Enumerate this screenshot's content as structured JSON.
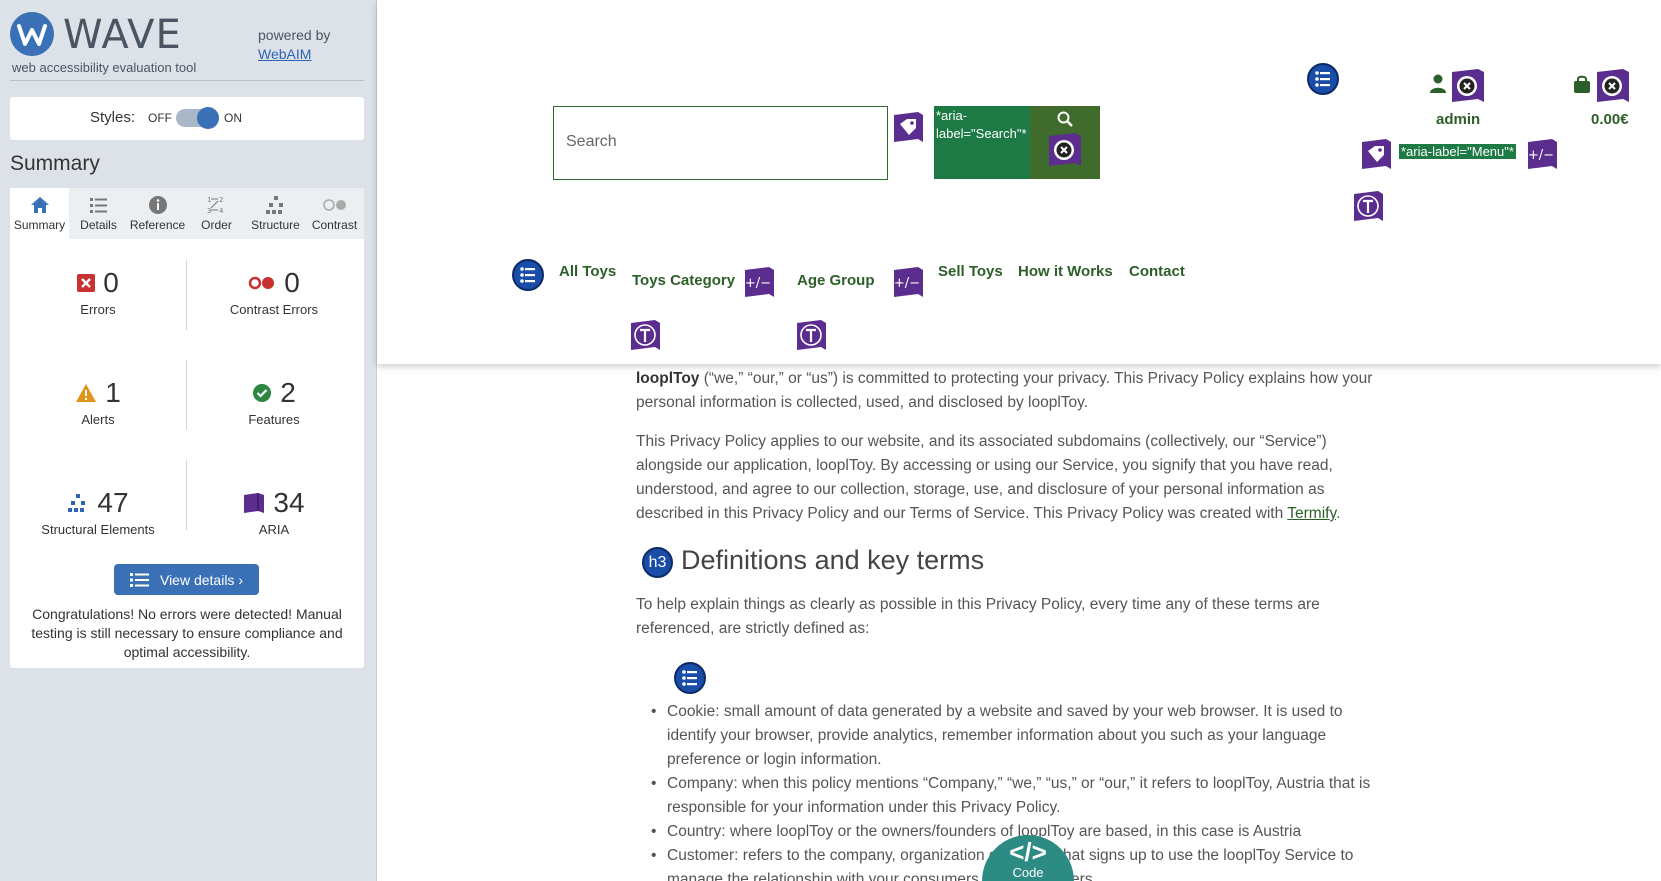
{
  "wave": {
    "title": "WAVE",
    "subtitle": "web accessibility evaluation tool",
    "powered_by": "powered by",
    "webaim_link": "WebAIM",
    "styles_label": "Styles:",
    "styles_off": "OFF",
    "styles_on": "ON",
    "styles_enabled": true,
    "summary_heading": "Summary",
    "tabs": [
      {
        "label": "Summary",
        "icon": "home-icon",
        "active": true
      },
      {
        "label": "Details",
        "icon": "list-icon",
        "active": false
      },
      {
        "label": "Reference",
        "icon": "info-icon",
        "active": false
      },
      {
        "label": "Order",
        "icon": "order-icon",
        "active": false
      },
      {
        "label": "Structure",
        "icon": "structure-icon",
        "active": false
      },
      {
        "label": "Contrast",
        "icon": "contrast-icon",
        "active": false
      }
    ],
    "stats": {
      "errors": {
        "value": "0",
        "label": "Errors"
      },
      "contrast_errors": {
        "value": "0",
        "label": "Contrast Errors"
      },
      "alerts": {
        "value": "1",
        "label": "Alerts"
      },
      "features": {
        "value": "2",
        "label": "Features"
      },
      "structural": {
        "value": "47",
        "label": "Structural Elements"
      },
      "aria": {
        "value": "34",
        "label": "ARIA"
      }
    },
    "view_details": "View details ›",
    "congrats": "Congratulations! No errors were detected! Manual testing is still necessary to ensure compliance and optimal accessibility.",
    "colors": {
      "accent": "#3a70b6",
      "error": "#c8312f",
      "alert": "#e0951b",
      "feature": "#2e8540",
      "aria": "#5b2d8e"
    }
  },
  "header": {
    "search_placeholder": "Search",
    "search_aria_label": "*aria-label=\"Search\"*",
    "menu_aria_label": "*aria-label=\"Menu\"*",
    "plus_minus": "+/−",
    "account_label": "admin",
    "cart_total": "0.00€",
    "nav": [
      "All Toys",
      "Toys Category",
      "Age Group",
      "Sell Toys",
      "How it Works",
      "Contact"
    ],
    "colors": {
      "brand": "#2d5f29",
      "search_button": "#3f6b2c",
      "aria_label_bg": "#1e7a44"
    }
  },
  "content": {
    "intro_brand": "looplToy",
    "intro_text": " (“we,” “our,” or “us”) is committed to protecting your privacy. This Privacy Policy explains how your personal information is collected, used, and disclosed by looplToy.",
    "para2_text": "This Privacy Policy applies to our website, and its associated subdomains (collectively, our “Service”) alongside our application, looplToy. By accessing or using our Service, you signify that you have read, understood, and agree to our collection, storage, use, and disclosure of your personal information as described in this Privacy Policy and our Terms of Service. This Privacy Policy was created with ",
    "para2_link": "Termify",
    "para2_end": ".",
    "heading_badge": "h3",
    "heading": "Definitions and key terms",
    "para3": "To help explain things as clearly as possible in this Privacy Policy, every time any of these terms are referenced, are strictly defined as:",
    "list": [
      "Cookie: small amount of data generated by a website and saved by your web browser. It is used to identify your browser, provide analytics, remember information about you such as your language preference or login information.",
      "Company: when this policy mentions “Company,” “we,” “us,” or “our,” it refers to looplToy, Austria that is responsible for your information under this Privacy Policy.",
      "Country: where looplToy or the owners/founders of looplToy are based, in this case is Austria",
      "Customer: refers to the company, organization or person that signs up to use the looplToy Service to manage the relationship with your consumers or service users."
    ],
    "code_tab_glyph": "</>",
    "code_tab_label": "Code"
  }
}
